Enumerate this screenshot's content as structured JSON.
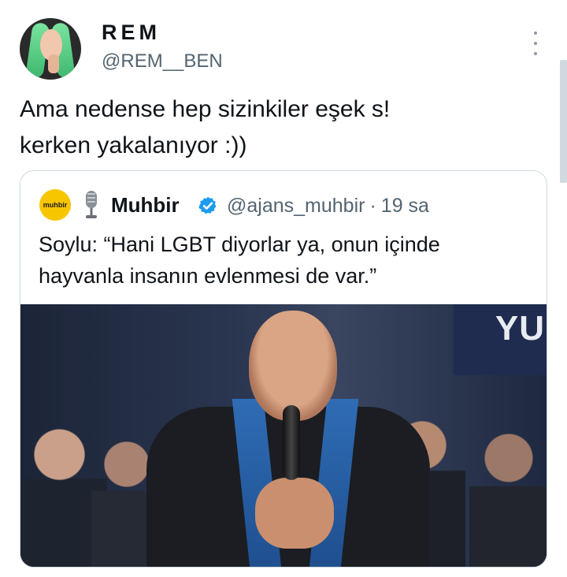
{
  "author": {
    "display_name": "REM",
    "handle": "@REM__BEN"
  },
  "tweet": {
    "lines": [
      "Ama nedense hep sizinkiler eşek s!",
      "kerken yakalanıyor :))"
    ]
  },
  "quote": {
    "avatar_label": "muhbir",
    "name": "Muhbir",
    "handle": "@ajans_muhbir",
    "separator": "·",
    "time": "19 sa",
    "lines": [
      "Soylu: “Hani LGBT diyorlar ya, onun içinde",
      "hayvanla insanın evlenmesi de var.”"
    ],
    "photo_sign_text": "YU"
  },
  "colors": {
    "text": "#0f1419",
    "secondary": "#536471",
    "border": "#cfd9de",
    "verified": "#1d9bf0",
    "muhbir_brand": "#f7c600"
  },
  "icons": {
    "more": "more-vertical-icon",
    "mic": "microphone-icon",
    "verified": "verified-badge-icon"
  }
}
